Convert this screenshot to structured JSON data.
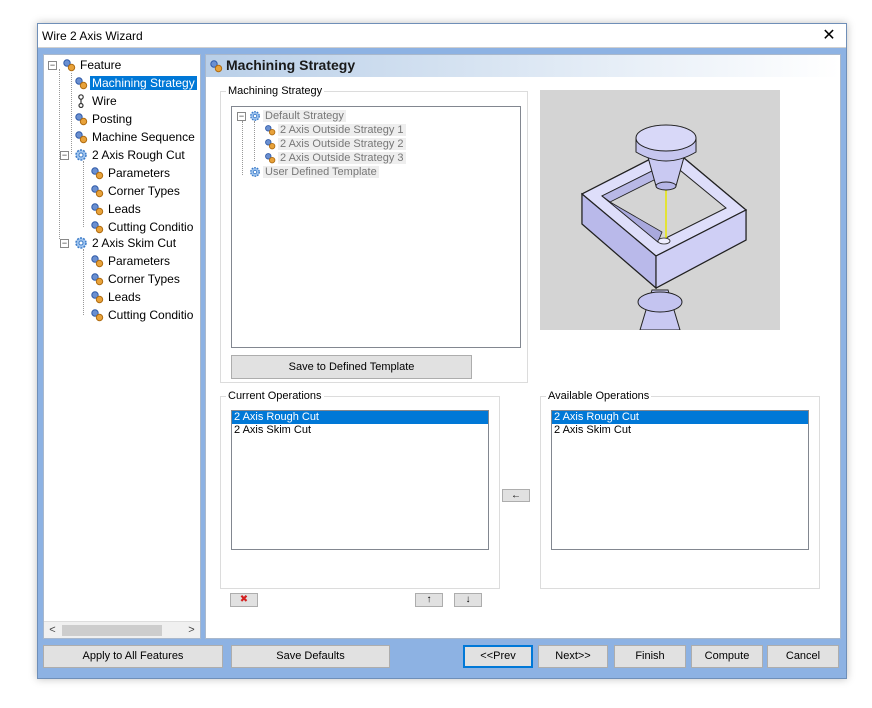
{
  "window": {
    "title": "Wire 2 Axis Wizard",
    "close_glyph": "✕"
  },
  "tree": {
    "items": [
      {
        "label": "Feature",
        "icon": "feature-icon"
      },
      {
        "label": "Machining Strategy",
        "icon": "gear-step-icon",
        "selected": true
      },
      {
        "label": "Wire",
        "icon": "wire-icon"
      },
      {
        "label": "Posting",
        "icon": "gear-step-icon"
      },
      {
        "label": "Machine Sequence",
        "icon": "gear-step-icon"
      },
      {
        "label": "2 Axis Rough Cut",
        "icon": "operation-gear-icon"
      },
      {
        "label": "Parameters",
        "icon": "gear-step-icon"
      },
      {
        "label": "Corner Types",
        "icon": "gear-step-icon"
      },
      {
        "label": "Leads",
        "icon": "gear-step-icon"
      },
      {
        "label": "Cutting Conditio",
        "icon": "gear-step-icon"
      },
      {
        "label": "2 Axis Skim Cut",
        "icon": "operation-gear-icon"
      },
      {
        "label": "Parameters",
        "icon": "gear-step-icon"
      },
      {
        "label": "Corner Types",
        "icon": "gear-step-icon"
      },
      {
        "label": "Leads",
        "icon": "gear-step-icon"
      },
      {
        "label": "Cutting Conditio",
        "icon": "gear-step-icon"
      }
    ],
    "collapse_glyph": "−",
    "scroll_left": "<",
    "scroll_right": ">"
  },
  "content": {
    "title": "Machining Strategy",
    "strategy_group_label": "Machining Strategy",
    "strategy_items": [
      {
        "label": "Default Strategy"
      },
      {
        "label": "2 Axis Outside Strategy 1"
      },
      {
        "label": "2 Axis Outside Strategy 2"
      },
      {
        "label": "2 Axis Outside Strategy 3"
      },
      {
        "label": "User Defined Template"
      }
    ],
    "save_template_button": "Save to Defined Template",
    "current_ops_label": "Current Operations",
    "current_ops": [
      "2 Axis Rough Cut",
      "2 Axis Skim Cut"
    ],
    "available_ops_label": "Available Operations",
    "available_ops": [
      "2 Axis Rough Cut",
      "2 Axis Skim Cut"
    ],
    "move_left_glyph": "←",
    "delete_glyph": "✖",
    "move_up_glyph": "↑",
    "move_down_glyph": "↓"
  },
  "buttons": {
    "apply_all": "Apply to All Features",
    "save_defaults": "Save Defaults",
    "prev": "<<Prev",
    "next": "Next>>",
    "finish": "Finish",
    "compute": "Compute",
    "cancel": "Cancel"
  },
  "colors": {
    "selection": "#0078d7",
    "frame": "#8db2e3",
    "model_fill": "#c9c9f2"
  }
}
